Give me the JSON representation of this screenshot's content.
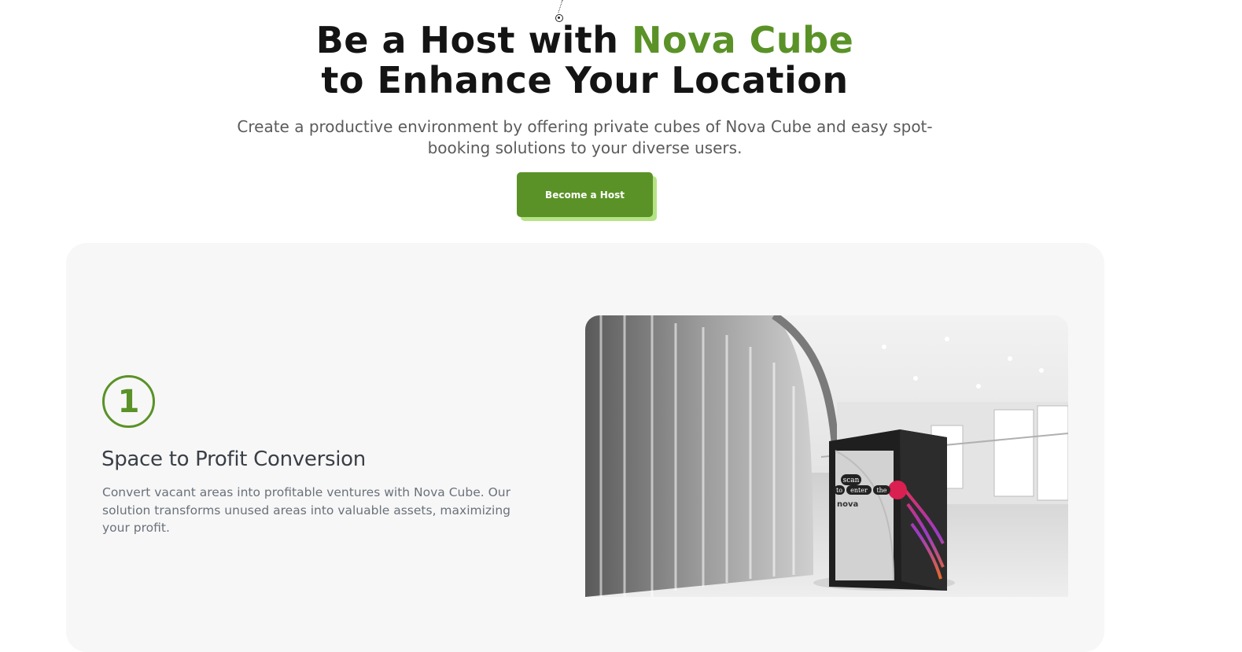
{
  "hero": {
    "headline_part1": "Be a Host with ",
    "headline_accent": "Nova Cube",
    "headline_line2": "to Enhance Your Location",
    "subtitle": "Create a productive environment by offering private cubes of Nova Cube and easy spot-booking solutions to your diverse users.",
    "cta_label": "Become a Host"
  },
  "feature": {
    "step_number": "1",
    "title": "Space to Profit Conversion",
    "description": "Convert vacant areas into profitable ventures with Nova Cube. Our solution transforms unused areas into valuable assets, maximizing your profit.",
    "image_alt": "Nova Cube booth in a shopping mall",
    "booth_text": {
      "scan": "scan",
      "to": "to",
      "enter": "enter",
      "the": "the",
      "brand": "nova"
    }
  },
  "colors": {
    "accent": "#5a9227",
    "accent_shadow": "#b5e384",
    "card_bg": "#f7f7f7",
    "heading": "#141414"
  }
}
